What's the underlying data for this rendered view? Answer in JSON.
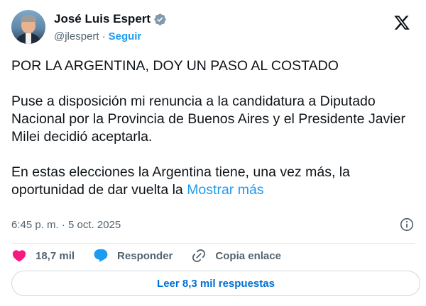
{
  "author": {
    "name": "José Luis Espert",
    "handle": "@jlespert",
    "separator": "·",
    "follow_label": "Seguir"
  },
  "tweet": {
    "paragraphs": [
      "POR LA ARGENTINA, DOY UN PASO AL COSTADO",
      "Puse a disposición mi renuncia a la candidatura a Diputado Nacional por la Provincia de Buenos Aires y el Presidente Javier Milei decidió aceptarla.",
      "En estas elecciones la Argentina tiene, una vez más, la oportunidad de dar vuelta la"
    ],
    "show_more_label": "Mostrar más",
    "timestamp": "6:45 p. m. · 5 oct. 2025"
  },
  "actions": {
    "likes": "18,7 mil",
    "reply_label": "Responder",
    "copy_link_label": "Copia enlace"
  },
  "replies_button_label": "Leer 8,3 mil respuestas",
  "icons": {
    "verified": "verified-badge-icon",
    "x_logo": "x-logo-icon",
    "info": "info-icon",
    "like": "heart-icon",
    "reply": "speech-bubble-icon",
    "link": "link-icon"
  },
  "colors": {
    "accent": "#1d9bf0",
    "like": "#f91880",
    "muted": "#536471",
    "text": "#0f1419"
  }
}
